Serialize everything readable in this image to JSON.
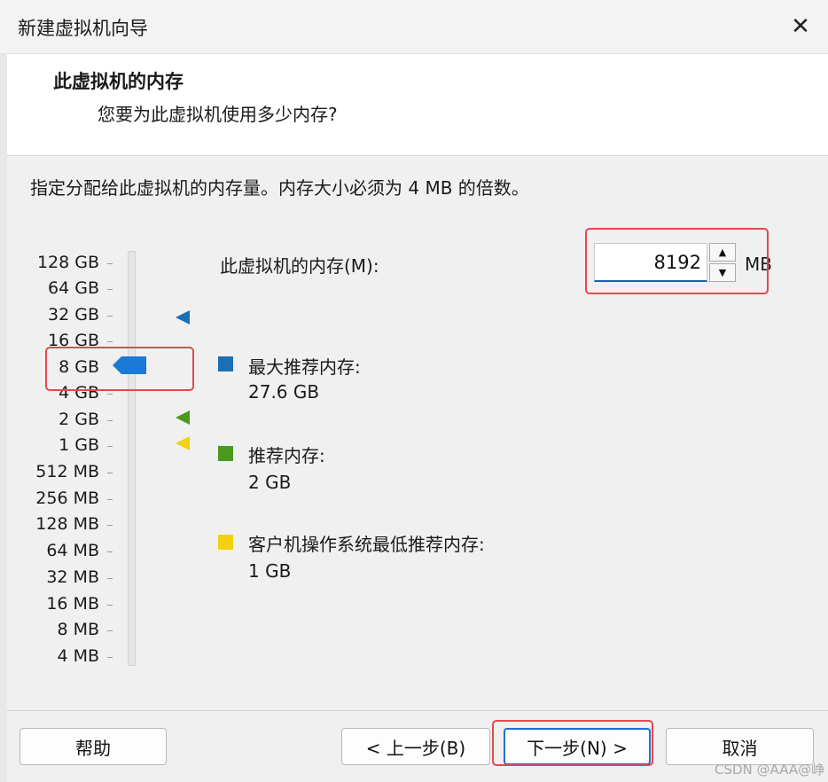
{
  "window": {
    "title": "新建虚拟机向导",
    "close_symbol": "✕"
  },
  "header": {
    "title": "此虚拟机的内存",
    "subtitle": "您要为此虚拟机使用多少内存?"
  },
  "instruction": "指定分配给此虚拟机的内存量。内存大小必须为 4 MB 的倍数。",
  "scale": {
    "labels": [
      "128 GB",
      "64 GB",
      "32 GB",
      "16 GB",
      "8 GB",
      "4 GB",
      "2 GB",
      "1 GB",
      "512 MB",
      "256 MB",
      "128 MB",
      "64 MB",
      "32 MB",
      "16 MB",
      "8 MB",
      "4 MB"
    ],
    "selected": "8 GB"
  },
  "memory": {
    "label": "此虚拟机的内存(M):",
    "value": "8192",
    "unit": "MB"
  },
  "legend": [
    {
      "title": "最大推荐内存:",
      "value": "27.6 GB",
      "color": "#1a6fb5",
      "marker_level": "32 GB"
    },
    {
      "title": "推荐内存:",
      "value": "2 GB",
      "color": "#4a9a1e",
      "marker_level": "2 GB"
    },
    {
      "title": "客户机操作系统最低推荐内存:",
      "value": "1 GB",
      "color": "#f2d20f",
      "marker_level": "1 GB"
    }
  ],
  "buttons": {
    "help": "帮助",
    "back": "< 上一步(B)",
    "next": "下一步(N) >",
    "cancel": "取消"
  },
  "watermark": "CSDN @AAA@峥"
}
